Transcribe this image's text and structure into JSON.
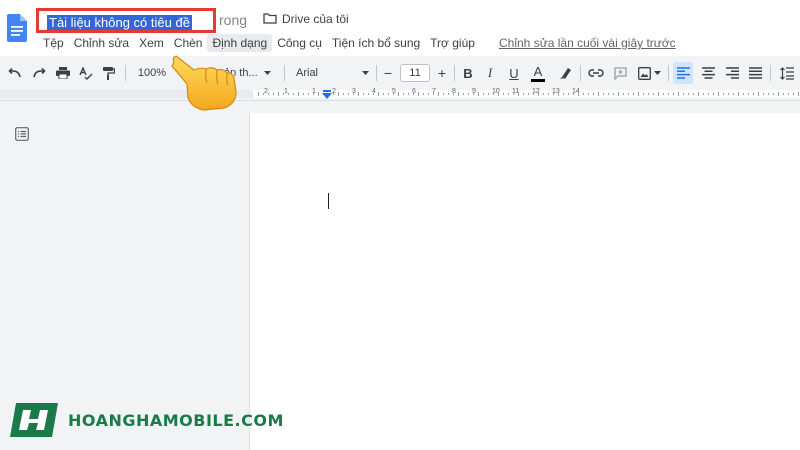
{
  "document": {
    "title": "Tài liệu không có tiêu đề",
    "title_tail": "rong",
    "drive_label": "Drive của tôi"
  },
  "menu": {
    "items": [
      "Tệp",
      "Chỉnh sửa",
      "Xem",
      "Chèn",
      "Định dạng",
      "Công cụ",
      "Tiện ích bổ sung",
      "Trợ giúp"
    ],
    "active_index": 4,
    "last_edit": "Chỉnh sửa lần cuối vài giây trước"
  },
  "toolbar": {
    "zoom": "100%",
    "style": "ản th...",
    "font": "Arial",
    "font_size": "11",
    "decrease": "−",
    "increase": "+",
    "bold": "B",
    "italic": "I",
    "underline": "U",
    "text_color": "A"
  },
  "ruler": {
    "labels": [
      "2",
      "1",
      "1",
      "2",
      "3",
      "4",
      "5",
      "6",
      "7",
      "8",
      "9",
      "10",
      "11",
      "12",
      "13",
      "14"
    ]
  },
  "brand": {
    "name": "HOANGHAMOBILE.COM"
  },
  "colors": {
    "highlight_border": "#e53935",
    "selection": "#3367d6",
    "docs_blue": "#4285f4",
    "brand_green": "#1b7a4a"
  },
  "icons": [
    "docs-logo-icon",
    "folder-icon",
    "undo-icon",
    "redo-icon",
    "print-icon",
    "spellcheck-icon",
    "paint-format-icon",
    "dropdown-arrow-icon",
    "highlighter-icon",
    "link-icon",
    "comment-icon",
    "image-icon",
    "align-left-icon",
    "align-center-icon",
    "align-right-icon",
    "align-justify-icon",
    "line-spacing-icon",
    "outline-icon",
    "pointing-hand-icon"
  ]
}
